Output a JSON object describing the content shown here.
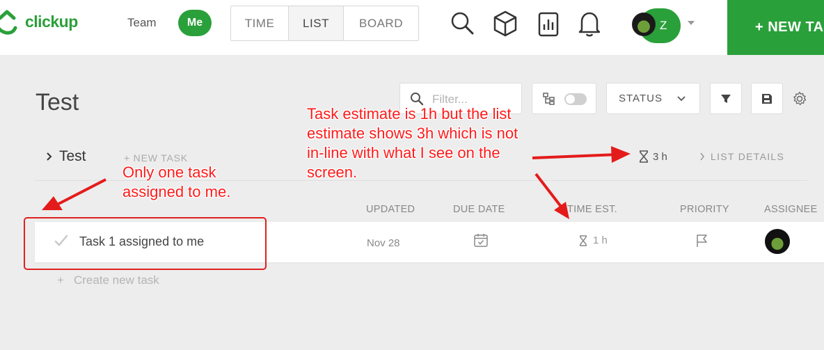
{
  "app": {
    "logo_text": "clickup",
    "team_label": "Team",
    "me_label": "Me",
    "view_tabs": [
      {
        "label": "TIME",
        "active": false
      },
      {
        "label": "LIST",
        "active": true
      },
      {
        "label": "BOARD",
        "active": false
      }
    ],
    "user_initial": "Z",
    "new_task_label": "+ NEW TASK",
    "brand_color": "#2aa03a"
  },
  "list": {
    "title": "Test",
    "filter_placeholder": "Filter...",
    "status_label": "STATUS"
  },
  "section": {
    "name": "Test",
    "new_task_label": "+ NEW TASK",
    "time_estimate": "3 h",
    "list_details_label": "LIST DETAILS"
  },
  "columns": {
    "updated": "UPDATED",
    "due_date": "DUE DATE",
    "time_est": "TIME EST.",
    "priority": "PRIORITY",
    "assignee": "ASSIGNEE"
  },
  "tasks": [
    {
      "name": "Task 1 assigned to me",
      "updated": "Nov 28",
      "time_estimate": "1 h"
    }
  ],
  "create_new_task_label": "Create new task",
  "annotations": {
    "estimate_note": "Task estimate is 1h but the list estimate shows 3h which is not in-line with what I see on the screen.",
    "assigned_note": "Only one task assigned to me.",
    "color": "#ff1a1a"
  }
}
